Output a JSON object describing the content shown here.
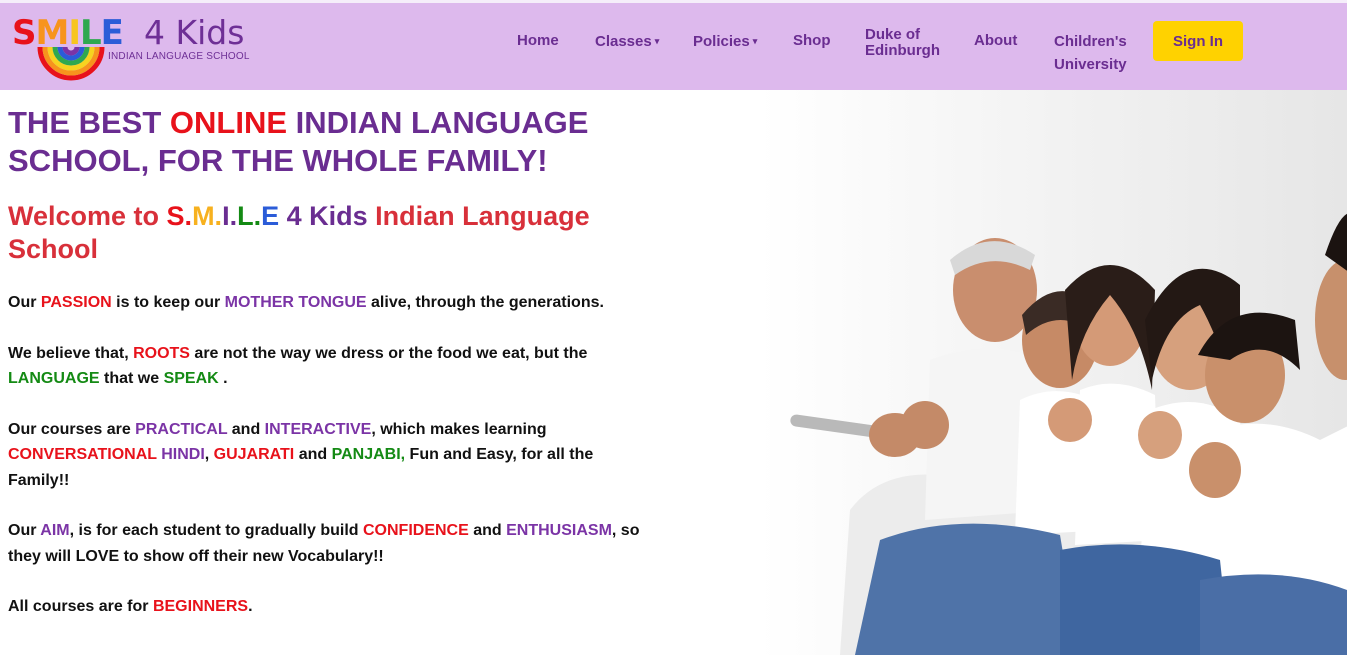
{
  "logo": {
    "letters": [
      "S",
      "M",
      "I",
      "L",
      "E"
    ],
    "kids": "4 Kids",
    "subtitle": "INDIAN LANGUAGE SCHOOL"
  },
  "nav": {
    "home": "Home",
    "classes": "Classes",
    "policies": "Policies",
    "shop": "Shop",
    "duke_line1": "Duke of",
    "duke_line2": "Edinburgh",
    "about": "About",
    "children_line1": "Children's",
    "children_line2": "University",
    "sign_in": "Sign In",
    "caret": "▾"
  },
  "headline": {
    "part1": "THE BEST ",
    "highlight": "ONLINE",
    "part2": " INDIAN LANGUAGE SCHOOL, FOR THE WHOLE FAMILY!"
  },
  "welcome": {
    "prefix": "Welcome to ",
    "s": "S.",
    "m": "M.",
    "i": "I.",
    "l": "L.",
    "e": "E",
    "kids": " 4 Kids",
    "suffix": " Indian Language School"
  },
  "p1": {
    "t1": "Our ",
    "passion": "PASSION",
    "t2": " is to keep our ",
    "mother_tongue": "MOTHER TONGUE",
    "t3": " alive, through the generations."
  },
  "p2": {
    "t1": "We believe that, ",
    "roots": "ROOTS",
    "t2": " are not the way we dress or the food we eat, but the ",
    "language": "LANGUAGE",
    "t3": " that we ",
    "speak": "SPEAK",
    "t4": " ."
  },
  "p3": {
    "t1": "Our courses are ",
    "practical": "PRACTICAL",
    "t2": " and ",
    "interactive": "INTERACTIVE",
    "t3": ", which makes learning ",
    "conversational": "CONVERSATIONAL",
    "t4": " ",
    "hindi": "HINDI",
    "t5": ", ",
    "gujarati": "GUJARATI",
    "t6": " and ",
    "panjabi": "PANJABI,",
    "t7": " Fun and Easy, for all the Family!!"
  },
  "p4": {
    "t1": "Our ",
    "aim": "AIM",
    "t2": ", is for each student to gradually build ",
    "confidence": "CONFIDENCE",
    "t3": " and ",
    "enthusiasm": "ENTHUSIASM",
    "t4": ", so they will LOVE to show off their new Vocabulary!!"
  },
  "p5": {
    "t1": "All courses are for ",
    "beginners": "BEGINNERS",
    "t2": "."
  },
  "colors": {
    "header_bg": "#ddb9ed",
    "purple": "#6a2d91",
    "red": "#e8121b",
    "green": "#148a14",
    "signin_bg": "#ffd200"
  }
}
